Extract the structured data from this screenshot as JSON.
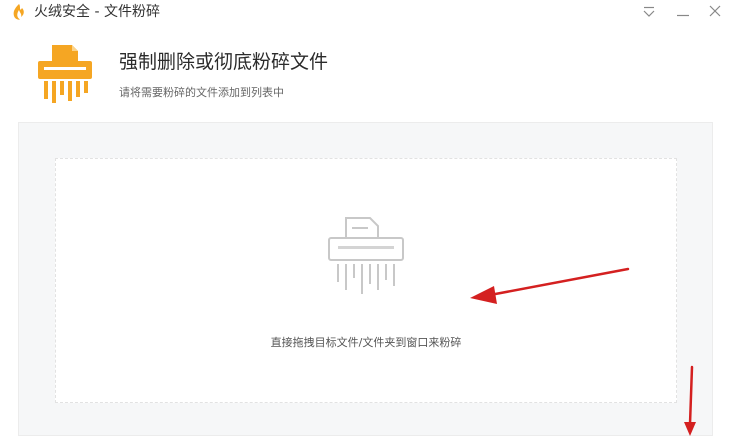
{
  "window": {
    "title": "火绒安全 - 文件粉碎",
    "logo_icon": "huorong-flame-icon",
    "buttons": [
      "menu-icon",
      "minimize-icon",
      "close-icon"
    ]
  },
  "header": {
    "title": "强制删除或彻底粉碎文件",
    "subtitle": "请将需要粉碎的文件添加到列表中",
    "icon": "shredder-icon",
    "icon_color": "#f5a623"
  },
  "dropzone": {
    "hint": "直接拖拽目标文件/文件夹到窗口来粉碎",
    "icon": "shredder-icon"
  },
  "colors": {
    "accent": "#f5a623",
    "annotation_arrow": "#d42020"
  }
}
